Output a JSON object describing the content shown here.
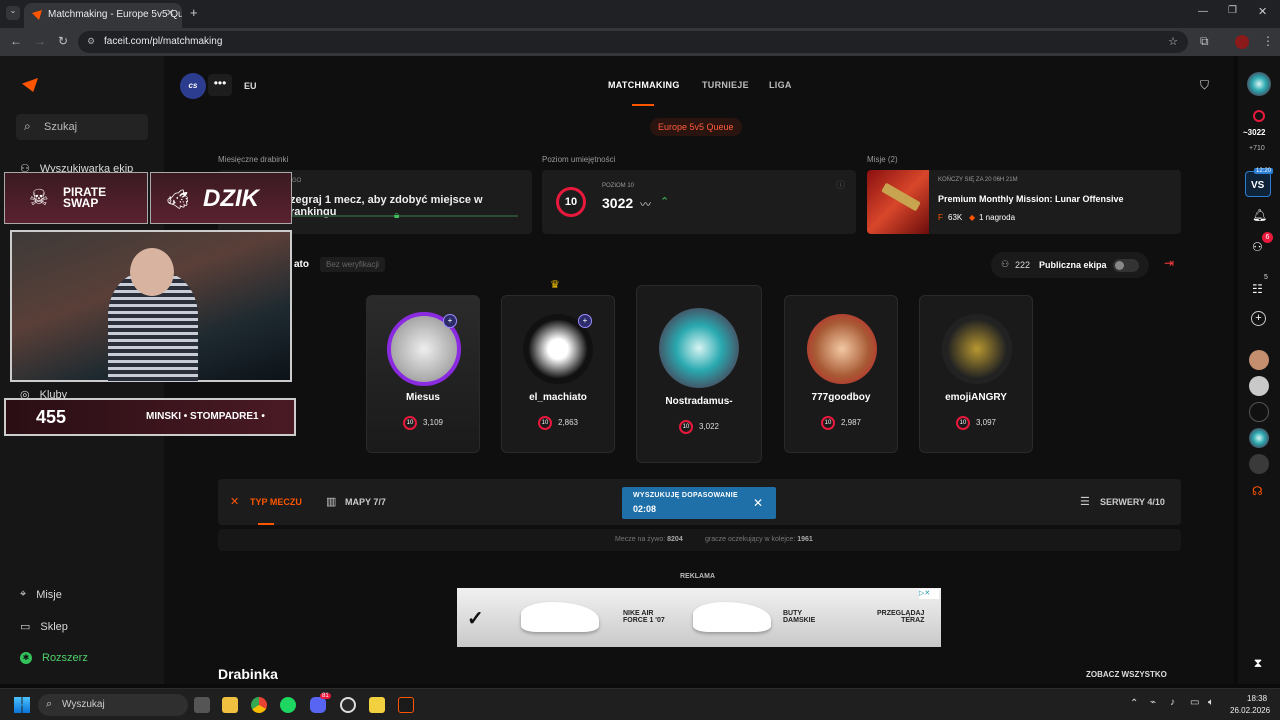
{
  "browser": {
    "tab_title": "Matchmaking - Europe 5v5 Qu",
    "url": "faceit.com/pl/matchmaking"
  },
  "sidebar": {
    "search_label": "Szukaj",
    "team_finder": "Wyszukiwarka ekip",
    "clubs": "Kluby",
    "missions": "Misje",
    "shop": "Sklep",
    "expand": "Rozszerz"
  },
  "header": {
    "game_badge": "cs",
    "region": "EU",
    "tabs": [
      "MATCHMAKING",
      "TURNIEJE",
      "LIGA"
    ],
    "queue": "Europe 5v5 Queue"
  },
  "cards": {
    "ladders_title": "Miesięczne drabinki",
    "ladders_text": "zegraj 1 mecz, aby zdobyć miejsce w rankingu",
    "ladders_small": "GO",
    "skill_title": "Poziom umiejętności",
    "skill_level_label": "POZIOM 10",
    "skill_level": "10",
    "skill_elo": "3022",
    "missions_title": "Misje (2)",
    "mission_ends": "KOŃCZY SIĘ ZA 20 06H 21M",
    "mission_name": "Premium Monthly Mission: Lunar Offensive",
    "mission_points": "63K",
    "mission_reward": "1 nagroda"
  },
  "party": {
    "name_fragment": "ato",
    "verification": "Bez weryfikacji",
    "count": "222",
    "public_label": "Publiczna ekipa",
    "players": [
      {
        "name": "Miesus",
        "elo": "3,109",
        "level": "10"
      },
      {
        "name": "el_machiato",
        "elo": "2,863",
        "level": "10"
      },
      {
        "name": "Nostradamus-",
        "elo": "3,022",
        "level": "10"
      },
      {
        "name": "777goodboy",
        "elo": "2,987",
        "level": "10"
      },
      {
        "name": "emojiANGRY",
        "elo": "3,097",
        "level": "10"
      }
    ]
  },
  "match": {
    "type_label": "TYP MECZU",
    "maps_label": "MAPY 7/7",
    "servers_label": "SERWERY 4/10",
    "searching_label": "WYSZUKUJĘ DOPASOWANIE",
    "timer": "02:08",
    "live_label": "Mecze na żywo:",
    "live_count": "8204",
    "queue_label": "gracze oczekujący w kolejce:",
    "queue_count": "1961"
  },
  "ad": {
    "label": "REKLAMA",
    "product1": "NIKE AIR\nFORCE 1 '07",
    "product2": "BUTY\nDAMSKIE",
    "cta": "PRZEGLĄDAJ\nTERAZ"
  },
  "ladder": {
    "title": "Drabinka",
    "see_all": "ZOBACZ WSZYSTKO"
  },
  "rightbar": {
    "elo": "~3022",
    "delta": "+710",
    "vs_time": "12:20",
    "vs_label": "VS",
    "friends_badge": "6",
    "party_badge": "5"
  },
  "overlay": {
    "sponsor1": "PIRATE\nSWAP",
    "sponsor2": "DZIK",
    "count": "455",
    "ticker": "MINSKI • STOMPADRE1 •"
  },
  "taskbar": {
    "search": "Wyszukaj",
    "time": "18:38",
    "date": "26.02.2026",
    "discord_badge": "81"
  },
  "colors": {
    "accent": "#ff5500",
    "level_red": "#e8193c",
    "searching_blue": "#1f6fa8"
  }
}
